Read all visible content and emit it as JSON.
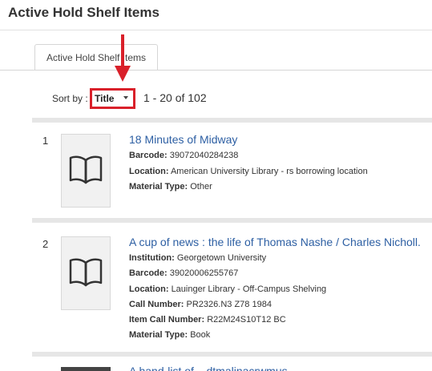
{
  "page": {
    "title": "Active Hold Shelf Items"
  },
  "tabs": [
    {
      "label": "Active Hold Shelf Items"
    }
  ],
  "sort": {
    "label": "Sort by :",
    "value": "Title"
  },
  "results": {
    "range_text": "1 - 20 of 102"
  },
  "items": [
    {
      "number": "1",
      "title": "18 Minutes of Midway",
      "fields": [
        {
          "label": "Barcode:",
          "value": "39072040284238"
        },
        {
          "label": "Location:",
          "value": "American University Library - rs borrowing location"
        },
        {
          "label": "Material Type:",
          "value": "Other"
        }
      ]
    },
    {
      "number": "2",
      "title": "A cup of news : the life of Thomas Nashe / Charles Nicholl.",
      "fields": [
        {
          "label": "Institution:",
          "value": "Georgetown University"
        },
        {
          "label": "Barcode:",
          "value": "39020006255767"
        },
        {
          "label": "Location:",
          "value": "Lauinger Library - Off-Campus Shelving"
        },
        {
          "label": "Call Number:",
          "value": "PR2326.N3 Z78 1984"
        },
        {
          "label": "Item Call Number:",
          "value": "R22M24S10T12 BC"
        },
        {
          "label": "Material Type:",
          "value": "Book"
        }
      ]
    }
  ],
  "next_item_peek": {
    "title": "A hand-list of... dtmalinacrwmus of ...ernerst"
  },
  "colors": {
    "accent_red": "#d9202a",
    "link_blue": "#2d5fa3"
  }
}
